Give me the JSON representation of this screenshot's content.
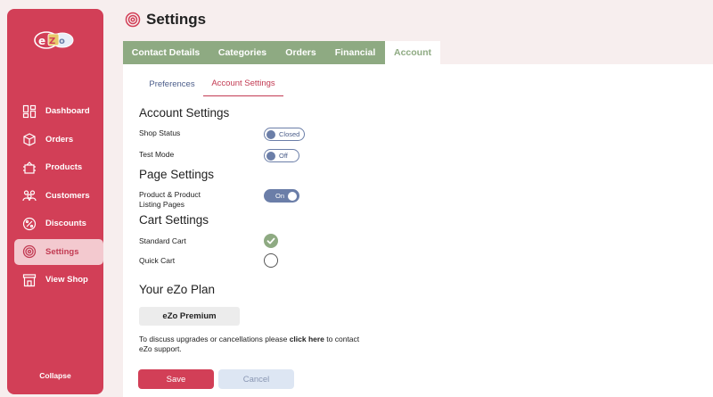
{
  "header": {
    "title": "Settings"
  },
  "sidebar": {
    "logo_text": "eZo",
    "items": [
      {
        "label": "Dashboard",
        "icon": "dashboard-icon"
      },
      {
        "label": "Orders",
        "icon": "orders-icon"
      },
      {
        "label": "Products",
        "icon": "products-icon"
      },
      {
        "label": "Customers",
        "icon": "customers-icon"
      },
      {
        "label": "Discounts",
        "icon": "discount-icon"
      },
      {
        "label": "Settings",
        "icon": "settings-icon",
        "active": true
      },
      {
        "label": "View Shop",
        "icon": "shop-icon"
      }
    ],
    "collapse_label": "Collapse"
  },
  "tabs": [
    {
      "label": "Contact Details"
    },
    {
      "label": "Categories"
    },
    {
      "label": "Orders"
    },
    {
      "label": "Financial"
    },
    {
      "label": "Account",
      "active": true
    }
  ],
  "subtabs": [
    {
      "label": "Preferences"
    },
    {
      "label": "Account Settings",
      "active": true
    }
  ],
  "account_settings": {
    "title": "Account Settings",
    "shop_status": {
      "label": "Shop Status",
      "value": "Closed"
    },
    "test_mode": {
      "label": "Test Mode",
      "value": "Off"
    }
  },
  "page_settings": {
    "title": "Page Settings",
    "product_pages": {
      "label_line1": "Product & Product",
      "label_line2": "Listing Pages",
      "value": "On"
    }
  },
  "cart_settings": {
    "title": "Cart Settings",
    "standard_cart": {
      "label": "Standard Cart",
      "checked": true
    },
    "quick_cart": {
      "label": "Quick Cart",
      "checked": false
    }
  },
  "plan": {
    "title": "Your eZo Plan",
    "name": "eZo Premium",
    "support_prefix": "To discuss upgrades or cancellations please ",
    "support_link": "click here",
    "support_suffix": " to contact eZo support."
  },
  "actions": {
    "save_label": "Save",
    "cancel_label": "Cancel"
  },
  "colors": {
    "brand": "#d23f57",
    "tab_green": "#8eaa82",
    "toggle_blue": "#6b7ea8",
    "background": "#f7eeee"
  }
}
